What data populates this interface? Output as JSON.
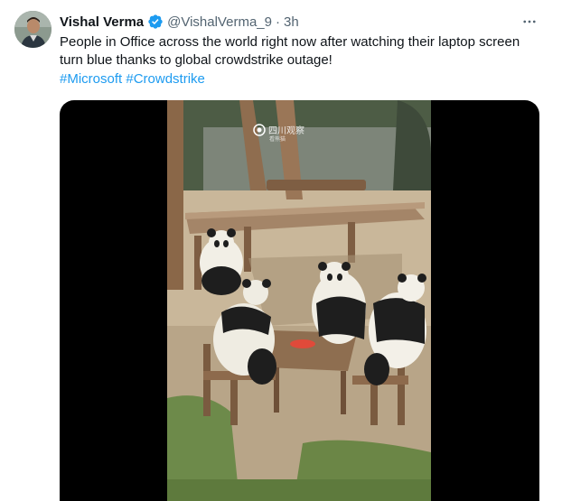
{
  "author": {
    "name": "Vishal Verma",
    "handle": "@VishalVerma_9",
    "separator": "·",
    "time": "3h"
  },
  "tweet": {
    "text": "People in Office across the world right now after watching their laptop screen turn blue thanks to global crowdstrike outage!",
    "hashtags": [
      "#Microsoft",
      "#Crowdstrike"
    ]
  },
  "media": {
    "watermark": "四川观察",
    "watermark_sub": "看熊猫",
    "icons": {
      "more": "more-icon",
      "verified": "verified-badge-icon"
    }
  },
  "colors": {
    "link": "#1d9bf0",
    "secondary_text": "#536471",
    "verified": "#1d9bf0"
  }
}
